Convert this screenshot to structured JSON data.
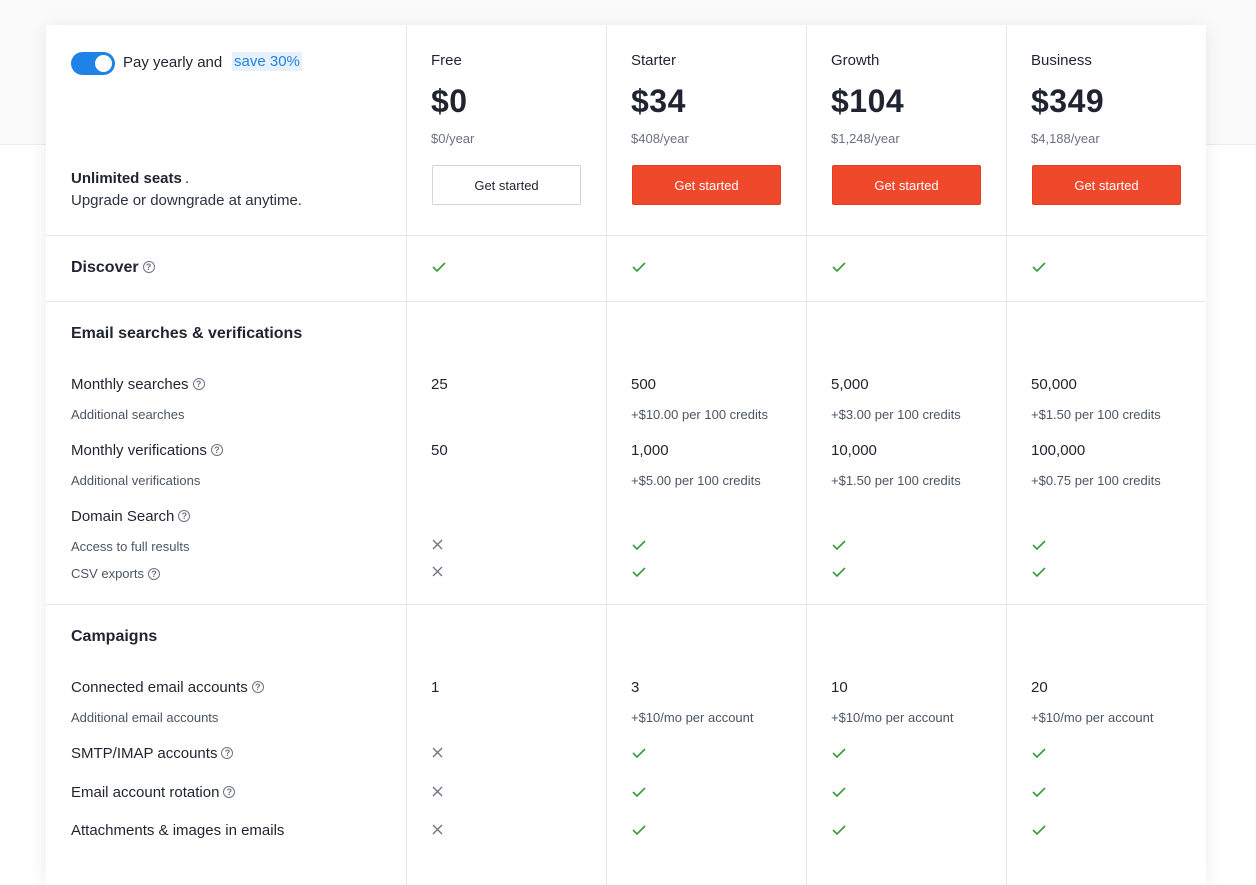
{
  "billing": {
    "toggle_on": true,
    "pay_text": "Pay yearly and",
    "save_text": "save 30%",
    "seats_bold": "Unlimited seats",
    "seats_dot": ".",
    "upgrade_text": "Upgrade or downgrade at anytime."
  },
  "plans": [
    {
      "name": "Free",
      "price": "$0",
      "yearly": "$0/year",
      "button": "Get started"
    },
    {
      "name": "Starter",
      "price": "$34",
      "yearly": "$408/year",
      "button": "Get started"
    },
    {
      "name": "Growth",
      "price": "$104",
      "yearly": "$1,248/year",
      "button": "Get started"
    },
    {
      "name": "Business",
      "price": "$349",
      "yearly": "$4,188/year",
      "button": "Get started"
    }
  ],
  "sections": {
    "discover": {
      "title": "Discover",
      "values": [
        "check",
        "check",
        "check",
        "check"
      ]
    },
    "email": {
      "title": "Email searches & verifications",
      "monthly_searches": {
        "label": "Monthly searches",
        "values": [
          "25",
          "500",
          "5,000",
          "50,000"
        ]
      },
      "additional_searches": {
        "label": "Additional searches",
        "values": [
          "",
          "+$10.00 per 100 credits",
          "+$3.00 per 100 credits",
          "+$1.50 per 100 credits"
        ]
      },
      "monthly_verifications": {
        "label": "Monthly verifications",
        "values": [
          "50",
          "1,000",
          "10,000",
          "100,000"
        ]
      },
      "additional_verifications": {
        "label": "Additional verifications",
        "values": [
          "",
          "+$5.00 per 100 credits",
          "+$1.50 per 100 credits",
          "+$0.75 per 100 credits"
        ]
      },
      "domain_search": {
        "label": "Domain Search"
      },
      "full_results": {
        "label": "Access to full results",
        "values": [
          "cross",
          "check",
          "check",
          "check"
        ]
      },
      "csv_exports": {
        "label": "CSV exports",
        "values": [
          "cross",
          "check",
          "check",
          "check"
        ]
      }
    },
    "campaigns": {
      "title": "Campaigns",
      "connected_accounts": {
        "label": "Connected email accounts",
        "values": [
          "1",
          "3",
          "10",
          "20"
        ]
      },
      "additional_accounts": {
        "label": "Additional email accounts",
        "values": [
          "",
          "+$10/mo per account",
          "+$10/mo per account",
          "+$10/mo per account"
        ]
      },
      "smtp": {
        "label": "SMTP/IMAP accounts",
        "values": [
          "cross",
          "check",
          "check",
          "check"
        ]
      },
      "rotation": {
        "label": "Email account rotation",
        "values": [
          "cross",
          "check",
          "check",
          "check"
        ]
      },
      "attachments": {
        "label": "Attachments & images in emails",
        "values": [
          "cross",
          "check",
          "check",
          "check"
        ]
      }
    }
  },
  "colors": {
    "accent": "#1f82e6",
    "cta": "#f0482b",
    "check": "#3a9a3a",
    "cross": "#6b7280"
  }
}
